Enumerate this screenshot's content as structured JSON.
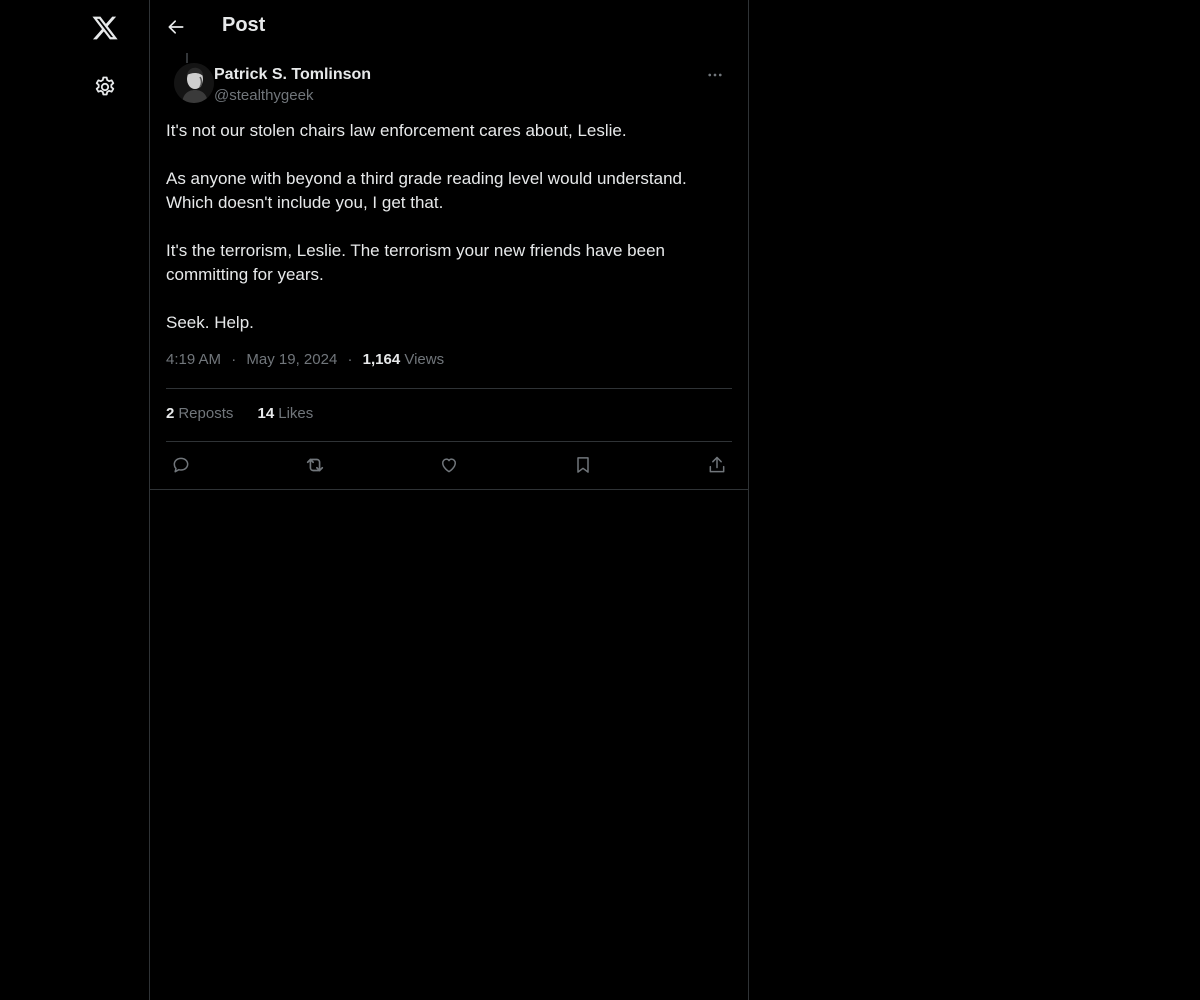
{
  "nav": {
    "logo_icon": "x-logo-icon",
    "settings_icon": "gear-icon"
  },
  "header": {
    "title": "Post",
    "back_icon": "arrow-left-icon"
  },
  "post": {
    "author": {
      "name": "Patrick S. Tomlinson",
      "handle": "@stealthygeek"
    },
    "paragraphs": [
      "It's not our stolen chairs law enforcement cares about, Leslie.",
      "As anyone with beyond a third grade reading level would understand. Which doesn't include you, I get that.",
      "It's the terrorism, Leslie. The terrorism your new friends have been committing for years.",
      "Seek. Help."
    ],
    "time": "4:19 AM",
    "date": "May 19, 2024",
    "separator": "·",
    "views_count": "1,164",
    "views_label": "Views",
    "reposts_count": "2",
    "reposts_label": "Reposts",
    "likes_count": "14",
    "likes_label": "Likes"
  },
  "colors": {
    "background": "#000000",
    "text_primary": "#e7e9ea",
    "text_secondary": "#71767b",
    "border": "#2f3336"
  }
}
